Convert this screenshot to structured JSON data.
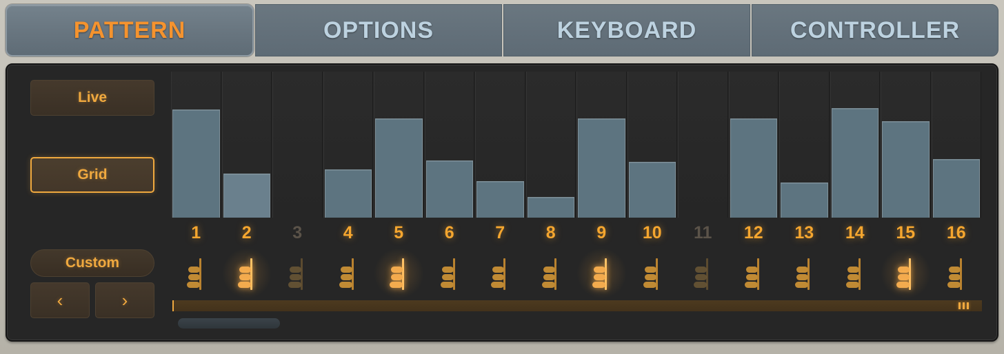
{
  "tabs": [
    {
      "label": "PATTERN",
      "active": true
    },
    {
      "label": "OPTIONS",
      "active": false
    },
    {
      "label": "KEYBOARD",
      "active": false
    },
    {
      "label": "CONTROLLER",
      "active": false
    }
  ],
  "sidebar": {
    "live_label": "Live",
    "grid_label": "Grid",
    "custom_label": "Custom",
    "prev_label": "‹",
    "next_label": "›"
  },
  "colors": {
    "accent_orange": "#f5a62f",
    "bar_fill": "#5d7480",
    "bar_fill_accent": "#6a808d",
    "bar_edge": "#7e9099",
    "panel_bg": "#262626",
    "frame_bg": "#c4c1b8",
    "tab_bg": "#63707a",
    "tab_text": "#bdd2e0",
    "dim_text": "#5b5349"
  },
  "chart_data": {
    "type": "bar",
    "title": "",
    "xlabel": "",
    "ylabel": "",
    "ylim": [
      0,
      100
    ],
    "grid": true,
    "categories": [
      "1",
      "2",
      "3",
      "4",
      "5",
      "6",
      "7",
      "8",
      "9",
      "10",
      "11",
      "12",
      "13",
      "14",
      "15",
      "16"
    ],
    "values": [
      74,
      30,
      0,
      33,
      68,
      39,
      25,
      14,
      68,
      38,
      0,
      68,
      24,
      75,
      66,
      40
    ],
    "step_active": [
      true,
      true,
      false,
      true,
      true,
      true,
      true,
      true,
      true,
      true,
      false,
      true,
      true,
      true,
      true,
      true
    ],
    "note_highlight": [
      false,
      true,
      false,
      false,
      true,
      false,
      false,
      false,
      true,
      false,
      false,
      false,
      false,
      false,
      true,
      false
    ]
  },
  "range_bar": {
    "grip_name": "resize-grip"
  }
}
